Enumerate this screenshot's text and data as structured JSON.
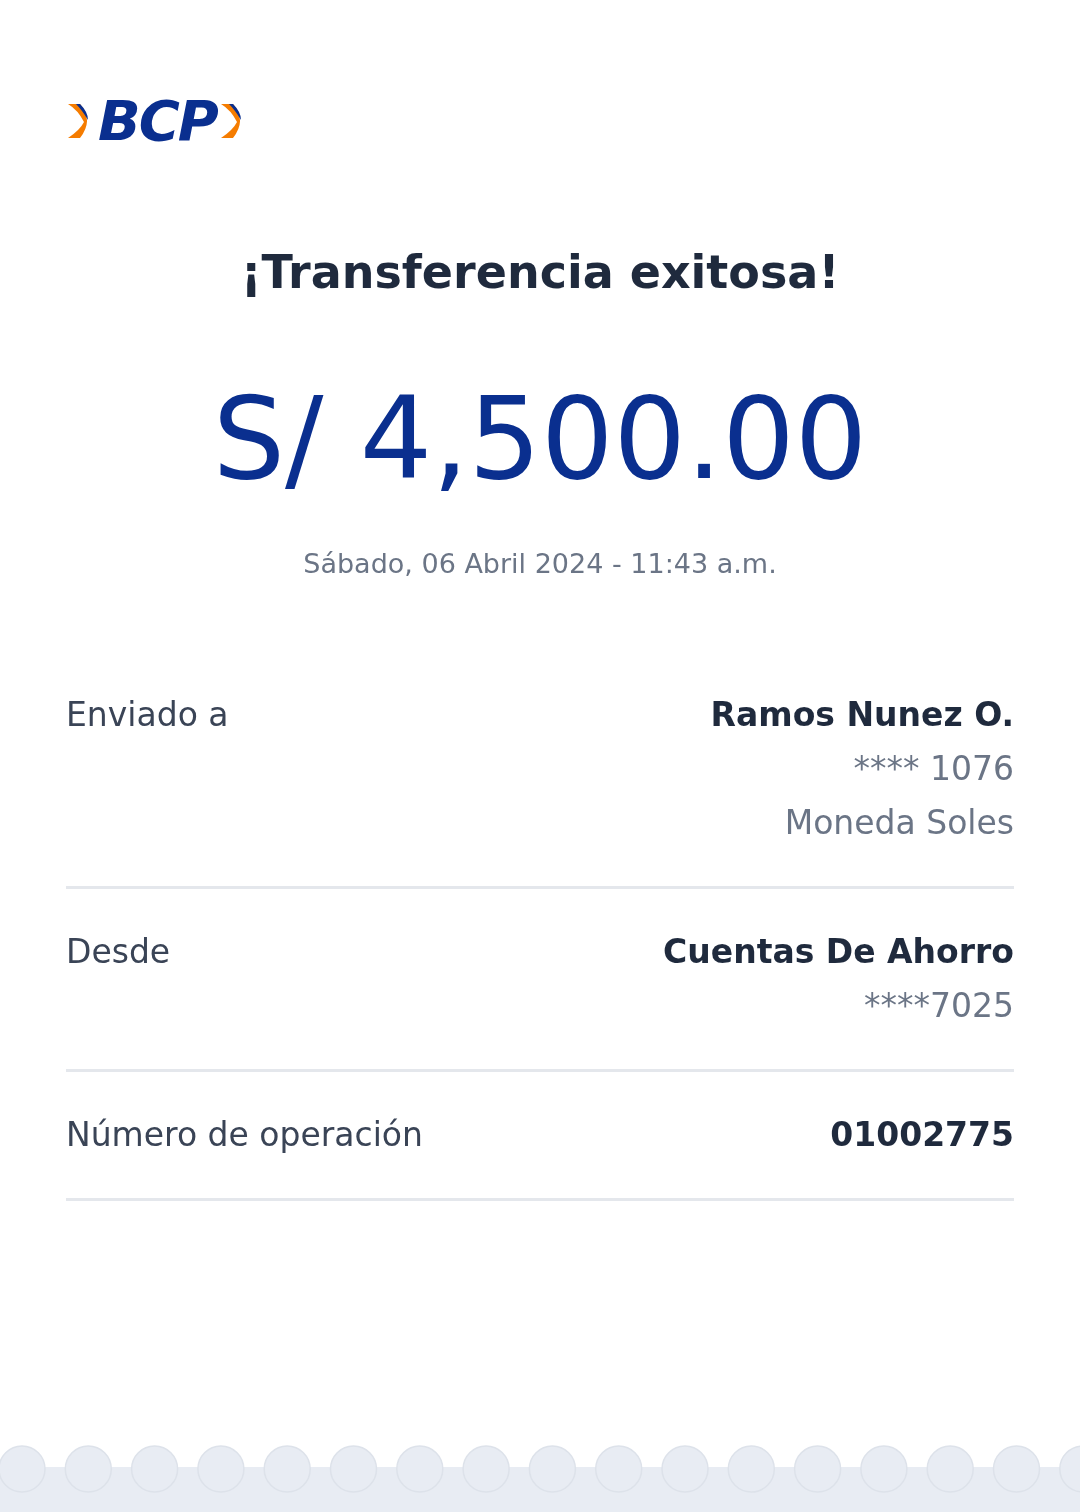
{
  "logo": {
    "text": "BCP"
  },
  "title": "¡Transferencia exitosa!",
  "amount": "S/ 4,500.00",
  "datetime": "Sábado, 06 Abril 2024 - 11:43 a.m.",
  "details": [
    {
      "label": "Enviado a",
      "lines": [
        {
          "text": "Ramos Nunez O.",
          "kind": "primary"
        },
        {
          "text": "**** 1076",
          "kind": "secondary"
        },
        {
          "text": "Moneda Soles",
          "kind": "secondary"
        }
      ]
    },
    {
      "label": "Desde",
      "lines": [
        {
          "text": "Cuentas De Ahorro",
          "kind": "primary"
        },
        {
          "text": "****7025",
          "kind": "secondary"
        }
      ]
    },
    {
      "label": "Número de operación",
      "lines": [
        {
          "text": "01002775",
          "kind": "primary"
        }
      ]
    }
  ]
}
